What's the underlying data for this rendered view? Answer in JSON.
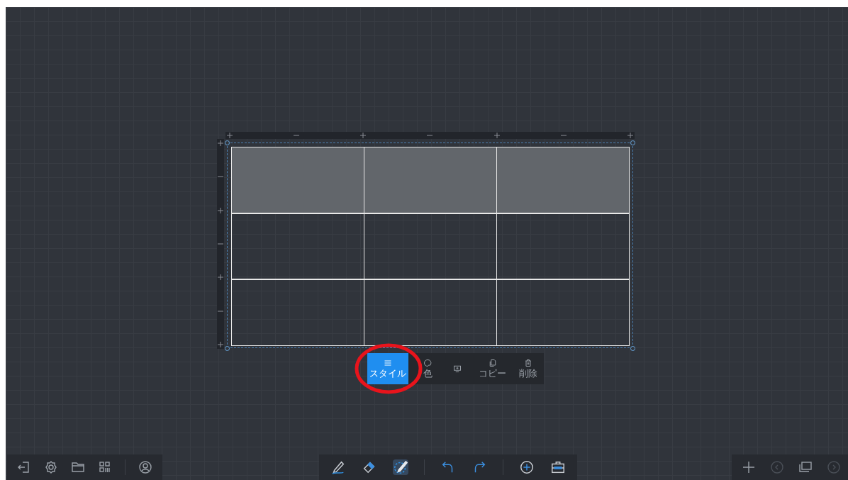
{
  "table": {
    "rows": [
      {
        "cells": [
          {
            "selected": true
          },
          {
            "selected": true
          },
          {
            "selected": true
          }
        ]
      },
      {
        "cells": [
          {
            "selected": false
          },
          {
            "selected": false
          },
          {
            "selected": false
          }
        ]
      },
      {
        "cells": [
          {
            "selected": false
          },
          {
            "selected": false
          },
          {
            "selected": false
          }
        ]
      }
    ]
  },
  "popup_toolbar": [
    {
      "kind": "style",
      "label": "スタイル",
      "selected": true
    },
    {
      "kind": "color",
      "label": "色",
      "selected": false
    },
    {
      "kind": "screen",
      "selected": false
    },
    {
      "kind": "copy",
      "label": "コピー",
      "selected": false
    },
    {
      "kind": "delete",
      "label": "削除",
      "selected": false
    }
  ],
  "left_toolbar": [
    {
      "kind": "exit"
    },
    {
      "kind": "settings"
    },
    {
      "kind": "folder"
    },
    {
      "kind": "apps"
    },
    {
      "kind": "divider"
    },
    {
      "kind": "user"
    }
  ],
  "center_toolbar": [
    {
      "kind": "pen",
      "selected": false
    },
    {
      "kind": "eraser",
      "selected": false
    },
    {
      "kind": "select",
      "selected": true
    },
    {
      "kind": "divider"
    },
    {
      "kind": "undo",
      "selected": false
    },
    {
      "kind": "redo",
      "selected": false
    },
    {
      "kind": "divider"
    },
    {
      "kind": "add",
      "selected": false
    },
    {
      "kind": "toolbox",
      "selected": false
    }
  ],
  "right_toolbar": [
    {
      "kind": "plus"
    },
    {
      "kind": "prev"
    },
    {
      "kind": "screens"
    },
    {
      "kind": "next"
    }
  ]
}
